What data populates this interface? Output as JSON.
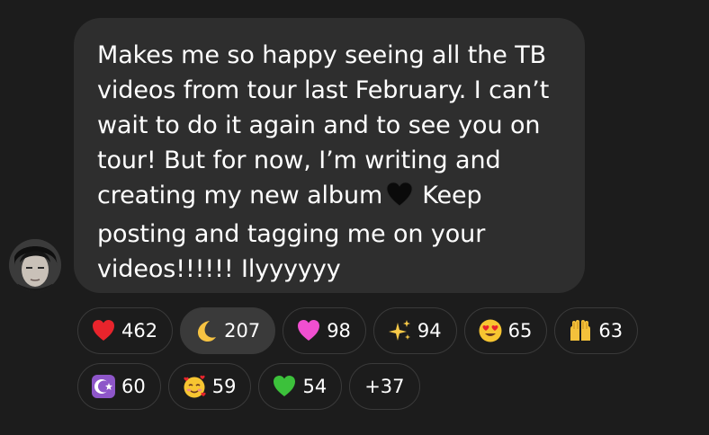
{
  "message": {
    "line_1": "Makes me so happy seeing all the TB",
    "line_2": "videos from tour last February. I can’t",
    "line_3": "wait to do it again and to see you on",
    "line_4": "tour! But for now, I’m writing and",
    "line_5_before_emoji": "creating my new album",
    "line_5_after_emoji": "Keep",
    "line_6": "posting and tagging me on your",
    "line_7": "videos!!!!!! Ilyyyyyy",
    "inline_emoji": "black-heart"
  },
  "reactions": [
    {
      "emoji": "red-heart",
      "count": "462",
      "selected": false
    },
    {
      "emoji": "crescent-moon",
      "count": "207",
      "selected": true
    },
    {
      "emoji": "pink-heart",
      "count": "98",
      "selected": false
    },
    {
      "emoji": "sparkles",
      "count": "94",
      "selected": false
    },
    {
      "emoji": "heart-eyes-face",
      "count": "65",
      "selected": false
    },
    {
      "emoji": "raising-hands",
      "count": "63",
      "selected": false
    },
    {
      "emoji": "star-and-crescent",
      "count": "60",
      "selected": false
    },
    {
      "emoji": "smiling-face-with-hearts",
      "count": "59",
      "selected": false
    },
    {
      "emoji": "green-heart",
      "count": "54",
      "selected": false
    }
  ],
  "more_reactions": "+37",
  "colors": {
    "background": "#1c1c1c",
    "bubble": "#2e2e2e",
    "pill_border": "#3a3a3a",
    "pill_selected": "#3a3a3a",
    "text": "#ffffff"
  }
}
